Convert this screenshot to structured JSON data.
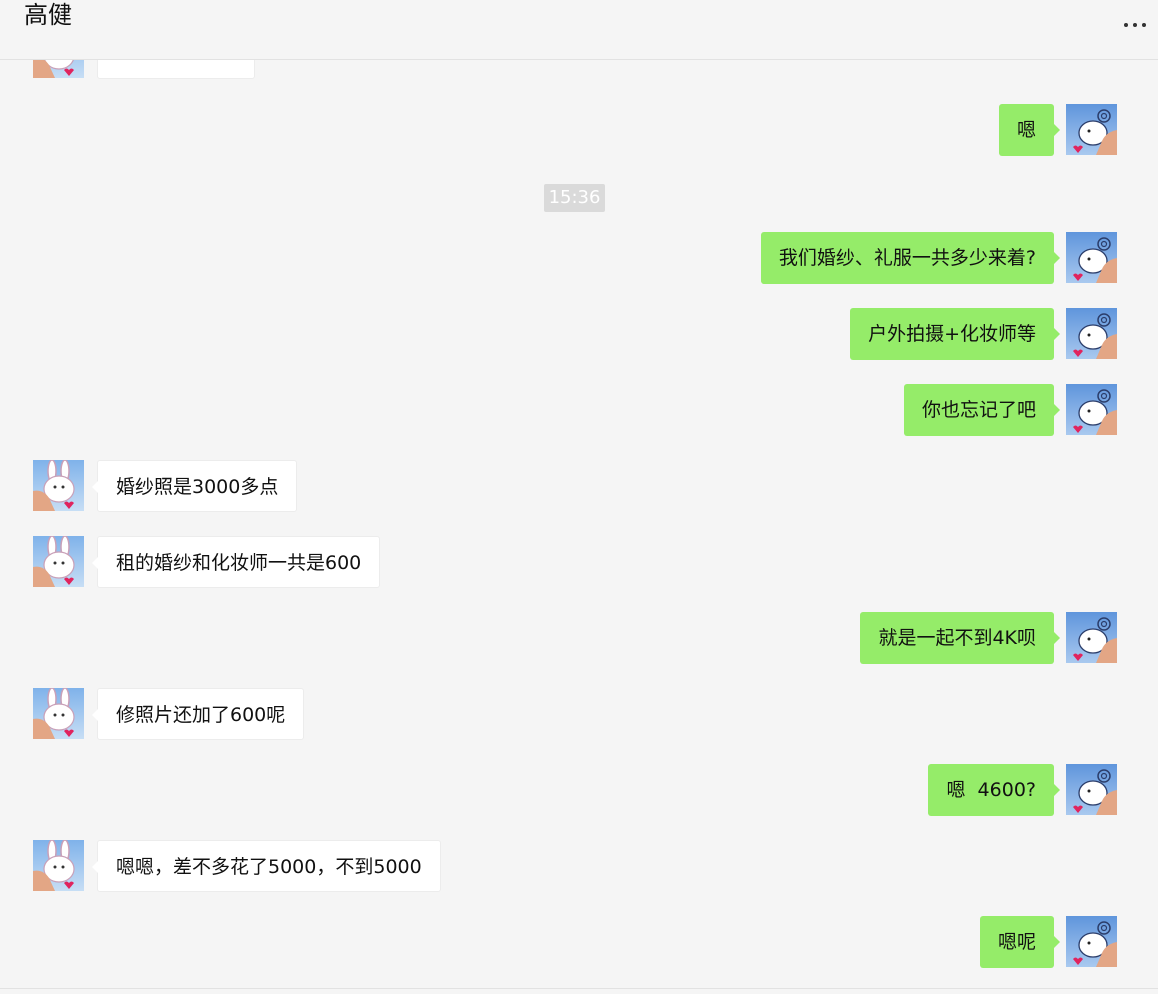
{
  "chat": {
    "contact_name": "高健",
    "more_icon": "more-horizontal-icon",
    "timestamp": "15:36",
    "colors": {
      "background": "#f5f5f5",
      "sent_bubble": "#95ec69",
      "received_bubble": "#ffffff",
      "timestamp_bg": "#dadada"
    },
    "messages": [
      {
        "side": "left",
        "text": ""
      },
      {
        "side": "right",
        "text": "嗯"
      },
      {
        "side": "right",
        "text": "我们婚纱、礼服一共多少来着?"
      },
      {
        "side": "right",
        "text": "户外拍摄+化妆师等"
      },
      {
        "side": "right",
        "text": "你也忘记了吧"
      },
      {
        "side": "left",
        "text": "婚纱照是3000多点"
      },
      {
        "side": "left",
        "text": "租的婚纱和化妆师一共是600"
      },
      {
        "side": "right",
        "text": "就是一起不到4K呗"
      },
      {
        "side": "left",
        "text": "修照片还加了600呢"
      },
      {
        "side": "right",
        "text": "嗯  4600?"
      },
      {
        "side": "left",
        "text": "嗯嗯，差不多花了5000，不到5000"
      },
      {
        "side": "right",
        "text": "嗯呢"
      }
    ]
  }
}
